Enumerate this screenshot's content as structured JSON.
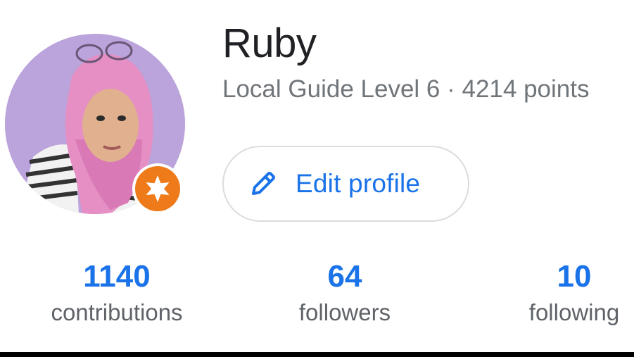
{
  "profile": {
    "name": "Ruby",
    "level_text": "Local Guide Level 6 · 4214 points",
    "avatar_icon": "user-photo",
    "badge_icon": "local-guide-star-icon",
    "badge_color": "#ee7a1a"
  },
  "actions": {
    "edit_profile_label": "Edit profile",
    "edit_icon": "pencil-icon"
  },
  "stats": {
    "contributions": {
      "value": "1140",
      "label": "contributions"
    },
    "followers": {
      "value": "64",
      "label": "followers"
    },
    "following": {
      "value": "10",
      "label": "following"
    }
  },
  "colors": {
    "accent": "#1a73e8",
    "primary_text": "#202124",
    "secondary_text": "#70757a"
  }
}
